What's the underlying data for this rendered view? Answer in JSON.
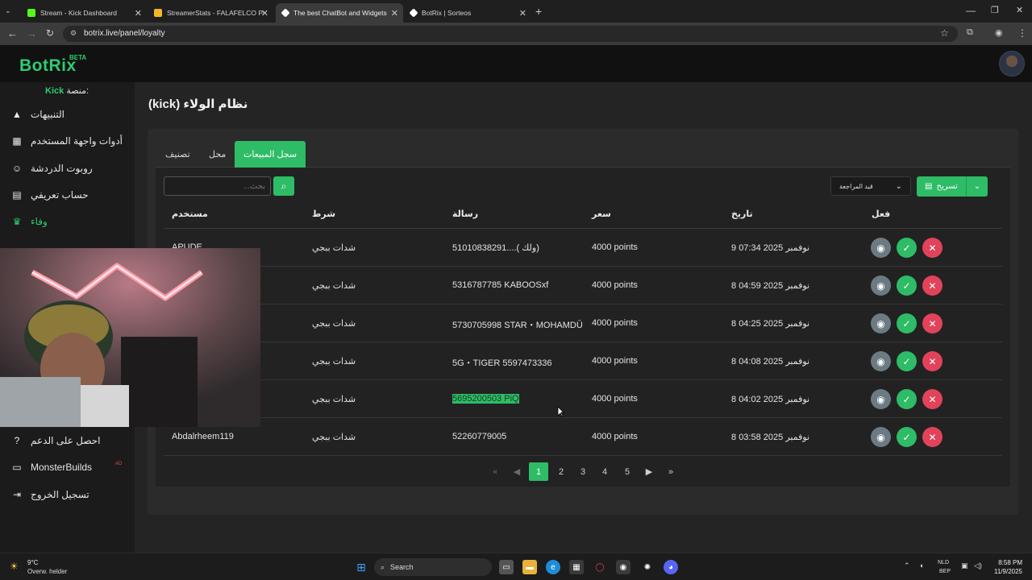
{
  "browser": {
    "tabs": [
      {
        "title": "Stream - Kick Dashboard",
        "favicon_color": "#53fc18"
      },
      {
        "title": "StreamerStats - FALAFELCO Pro",
        "favicon_color": "#f5b62a"
      },
      {
        "title": "The best ChatBot and Widgets",
        "favicon_color": "#ffffff"
      },
      {
        "title": "BotRix | Sorteos",
        "favicon_color": "#ffffff"
      }
    ],
    "url": "botrix.live/panel/loyalty"
  },
  "app": {
    "logo": "BotRix",
    "logo_badge": "BETA",
    "platform_label": "منصة:",
    "platform_value": "Kick",
    "accent": "#2ebc66"
  },
  "sidebar": {
    "items": [
      {
        "label": "التنبيهات",
        "icon": "warning-icon"
      },
      {
        "label": "أدوات واجهة المستخدم",
        "icon": "widgets-icon"
      },
      {
        "label": "روبوت الدردشة",
        "icon": "robot-icon"
      },
      {
        "label": "حساب تعريفي",
        "icon": "id-card-icon"
      },
      {
        "label": "وفاء",
        "icon": "trophy-icon",
        "active": true
      },
      {
        "label": "احصل على الدعم",
        "icon": "help-icon"
      },
      {
        "label": "MonsterBuilds",
        "icon": "laptop-icon"
      },
      {
        "label": "تسجيل الخروج",
        "icon": "logout-icon"
      }
    ],
    "monsterbuilds_badge": "AD"
  },
  "main": {
    "title": "نظام الولاء (kick)",
    "tabs": [
      "سجل المبيعات",
      "محل",
      "تصنيف"
    ],
    "search_placeholder": "بحث...",
    "status_filter": "قيد المراجعة",
    "export_label": "تسريح",
    "columns": [
      "مستخدم",
      "شرط",
      "رسالة",
      "سعر",
      "تاريخ",
      "فعل"
    ],
    "rows": [
      {
        "user": "APUDE",
        "item": "شدات ببجي",
        "message": "51010838291....( ولك)",
        "price": "4000 points",
        "date": "9 نوفمبر 2025 07:34"
      },
      {
        "user": "",
        "item": "شدات ببجي",
        "message": "5316787785 KABOOSxf",
        "price": "4000 points",
        "date": "8 نوفمبر 2025 04:59"
      },
      {
        "user": "",
        "item": "شدات ببجي",
        "message": "5730705998 STAR・MOHAMDŪ",
        "price": "4000 points",
        "date": "8 نوفمبر 2025 04:25"
      },
      {
        "user": "",
        "item": "شدات ببجي",
        "message": "5G・TIGER 5597473336",
        "price": "4000 points",
        "date": "8 نوفمبر 2025 04:08"
      },
      {
        "user": "",
        "item": "شدات ببجي",
        "message": "5695200503 PiQ",
        "price": "4000 points",
        "date": "8 نوفمبر 2025 04:02",
        "highlight": true
      },
      {
        "user": "Abdalrheem119",
        "item": "شدات ببجي",
        "message": "52260779005",
        "price": "4000 points",
        "date": "8 نوفمبر 2025 03:58"
      }
    ],
    "pagination": {
      "pages": [
        "1",
        "2",
        "3",
        "4",
        "5"
      ],
      "current": 1
    }
  },
  "taskbar": {
    "weather_temp": "9°C",
    "weather_desc": "Overw. helder",
    "search_label": "Search",
    "lang_line1": "NLD",
    "lang_line2": "BEP",
    "time": "8:58 PM",
    "date": "11/9/2025"
  }
}
